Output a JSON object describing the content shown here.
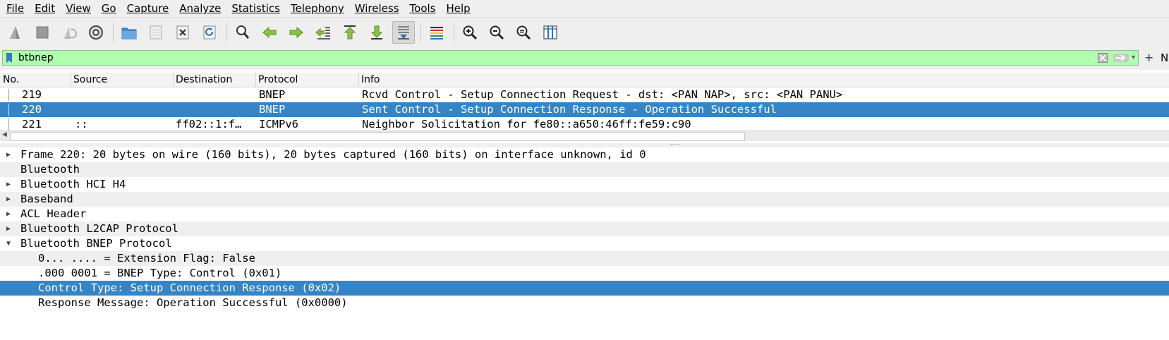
{
  "menu": [
    "File",
    "Edit",
    "View",
    "Go",
    "Capture",
    "Analyze",
    "Statistics",
    "Telephony",
    "Wireless",
    "Tools",
    "Help"
  ],
  "toolbar": {
    "icons": [
      "shark-fin-icon",
      "stop-icon",
      "restart-icon",
      "options-gear-icon",
      "open-folder-icon",
      "save-icon",
      "close-file-icon",
      "reload-icon",
      "find-icon",
      "back-arrow-icon",
      "forward-arrow-icon",
      "go-to-packet-icon",
      "first-packet-icon",
      "last-packet-icon",
      "autoscroll-icon",
      "colorize-icon",
      "zoom-in-icon",
      "zoom-out-icon",
      "zoom-reset-icon",
      "resize-columns-icon"
    ]
  },
  "filter": {
    "value": "btbnep",
    "trailing": "N"
  },
  "packet_list": {
    "columns": [
      "No.",
      "Source",
      "Destination",
      "Protocol",
      "Info"
    ],
    "rows": [
      {
        "no": "219",
        "source": "",
        "destination": "",
        "protocol": "BNEP",
        "info": "Rcvd Control - Setup Connection Request - dst: <PAN NAP>, src: <PAN PANU>"
      },
      {
        "no": "220",
        "source": "",
        "destination": "",
        "protocol": "BNEP",
        "info": "Sent Control - Setup Connection Response - Operation Successful"
      },
      {
        "no": "221",
        "source": "::",
        "destination": "ff02::1:f…",
        "protocol": "ICMPv6",
        "info": "Neighbor Solicitation for fe80::a650:46ff:fe59:c90"
      }
    ]
  },
  "details": {
    "rows": [
      {
        "text": "Frame 220: 20 bytes on wire (160 bits), 20 bytes captured (160 bits) on interface unknown, id 0",
        "expander": "▶"
      },
      {
        "text": "Bluetooth",
        "expander": ""
      },
      {
        "text": "Bluetooth HCI H4",
        "expander": "▶"
      },
      {
        "text": "Baseband",
        "expander": "▶"
      },
      {
        "text": "ACL Header",
        "expander": "▶"
      },
      {
        "text": "Bluetooth L2CAP Protocol",
        "expander": "▶"
      },
      {
        "text": "Bluetooth BNEP Protocol",
        "expander": "▼"
      },
      {
        "text": "0... .... = Extension Flag: False",
        "expander": ""
      },
      {
        "text": ".000 0001 = BNEP Type: Control (0x01)",
        "expander": ""
      },
      {
        "text": "Control Type: Setup Connection Response (0x02)",
        "expander": ""
      },
      {
        "text": "Response Message: Operation Successful (0x0000)",
        "expander": ""
      }
    ]
  },
  "colors": {
    "selection": "#3585c6",
    "filter_valid": "#afffaf"
  }
}
